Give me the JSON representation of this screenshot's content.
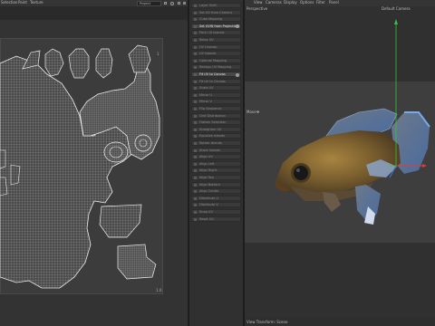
{
  "uv_editor": {
    "menus": [
      "Selection",
      "Paint",
      "Texture"
    ],
    "project_label": "Project",
    "grid_top_label": "1",
    "grid_bottom_label": "1.0"
  },
  "command_panel": {
    "items": [
      {
        "label": "Layer Shift"
      },
      {
        "label": "Set UV from Camera"
      },
      {
        "label": "Cube Mapping"
      },
      {
        "label": "Set UVW from Projection",
        "highlight": true
      },
      {
        "label": "Pack UV Islands"
      },
      {
        "label": "Relax UV"
      },
      {
        "label": "UV Unwrap"
      },
      {
        "label": "UV Islands"
      },
      {
        "label": "Optimal Mapping"
      },
      {
        "label": "Realign UV Mapping"
      },
      {
        "label": "Fit UV to Canvas",
        "highlight": true
      },
      {
        "label": "Fit UV to Canvas"
      },
      {
        "label": "Scale UV"
      },
      {
        "label": "Mirror U"
      },
      {
        "label": "Mirror V"
      },
      {
        "label": "Flip Sequence"
      },
      {
        "label": "Grid Distribution"
      },
      {
        "label": "Flatten Selection"
      },
      {
        "label": "Straighten UV"
      },
      {
        "label": "Equalize Islands"
      },
      {
        "label": "Rotate Islands"
      },
      {
        "label": "Stack Islands"
      },
      {
        "label": "Align UV"
      },
      {
        "label": "Align Left"
      },
      {
        "label": "Align Right"
      },
      {
        "label": "Align Top"
      },
      {
        "label": "Align Bottom"
      },
      {
        "label": "Align Center"
      },
      {
        "label": "Distribute U"
      },
      {
        "label": "Distribute V"
      },
      {
        "label": "Snap UV"
      },
      {
        "label": "Reset UV"
      }
    ]
  },
  "viewport": {
    "menus": [
      "View",
      "Cameras",
      "Display",
      "Options",
      "Filter",
      "Panel"
    ],
    "view_label": "Perspective",
    "camera_label": "Default Camera",
    "camera_marker": "◦",
    "move_label": "Move",
    "move_marker": "✥",
    "footer_label": "View Transform: Scene"
  },
  "colors": {
    "gizmo_x": "#e03c3c",
    "gizmo_y": "#3cc03c",
    "gizmo_z": "#3c78e0",
    "uv_wire": "#e8e8e8"
  }
}
